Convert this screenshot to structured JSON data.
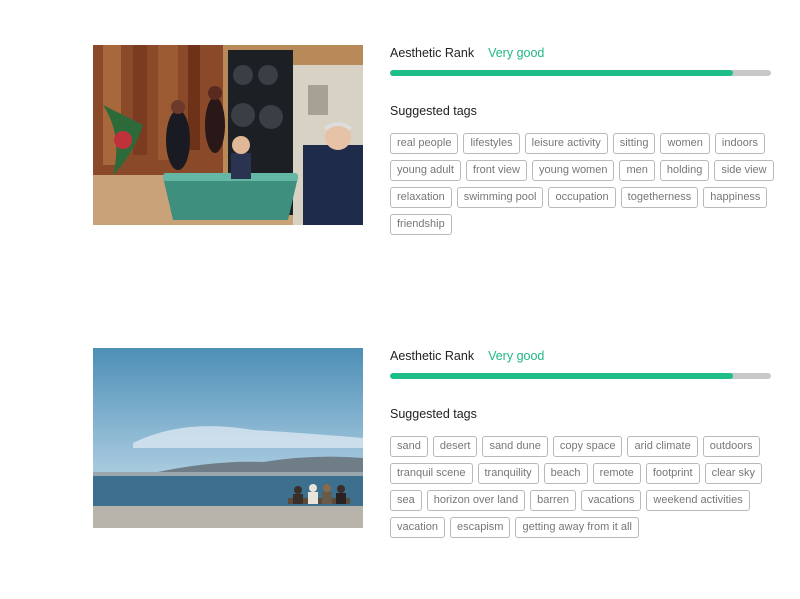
{
  "results": [
    {
      "rank_label": "Aesthetic Rank",
      "rank_value": "Very good",
      "rank_score": 0.9,
      "tags_title": "Suggested tags",
      "tags": [
        "real people",
        "lifestyles",
        "leisure activity",
        "sitting",
        "women",
        "indoors",
        "young adult",
        "front view",
        "young women",
        "men",
        "holding",
        "side view",
        "relaxation",
        "swimming pool",
        "occupation",
        "togetherness",
        "happiness",
        "friendship"
      ]
    },
    {
      "rank_label": "Aesthetic Rank",
      "rank_value": "Very good",
      "rank_score": 0.9,
      "tags_title": "Suggested tags",
      "tags": [
        "sand",
        "desert",
        "sand dune",
        "copy space",
        "arid climate",
        "outdoors",
        "tranquil scene",
        "tranquility",
        "beach",
        "remote",
        "footprint",
        "clear sky",
        "sea",
        "horizon over land",
        "barren",
        "vacations",
        "weekend activities",
        "vacation",
        "escapism",
        "getting away from it all"
      ]
    }
  ],
  "colors": {
    "accent": "#1fb985",
    "bar_track": "#c8c8c8",
    "tag_border": "#b9b9b9"
  }
}
